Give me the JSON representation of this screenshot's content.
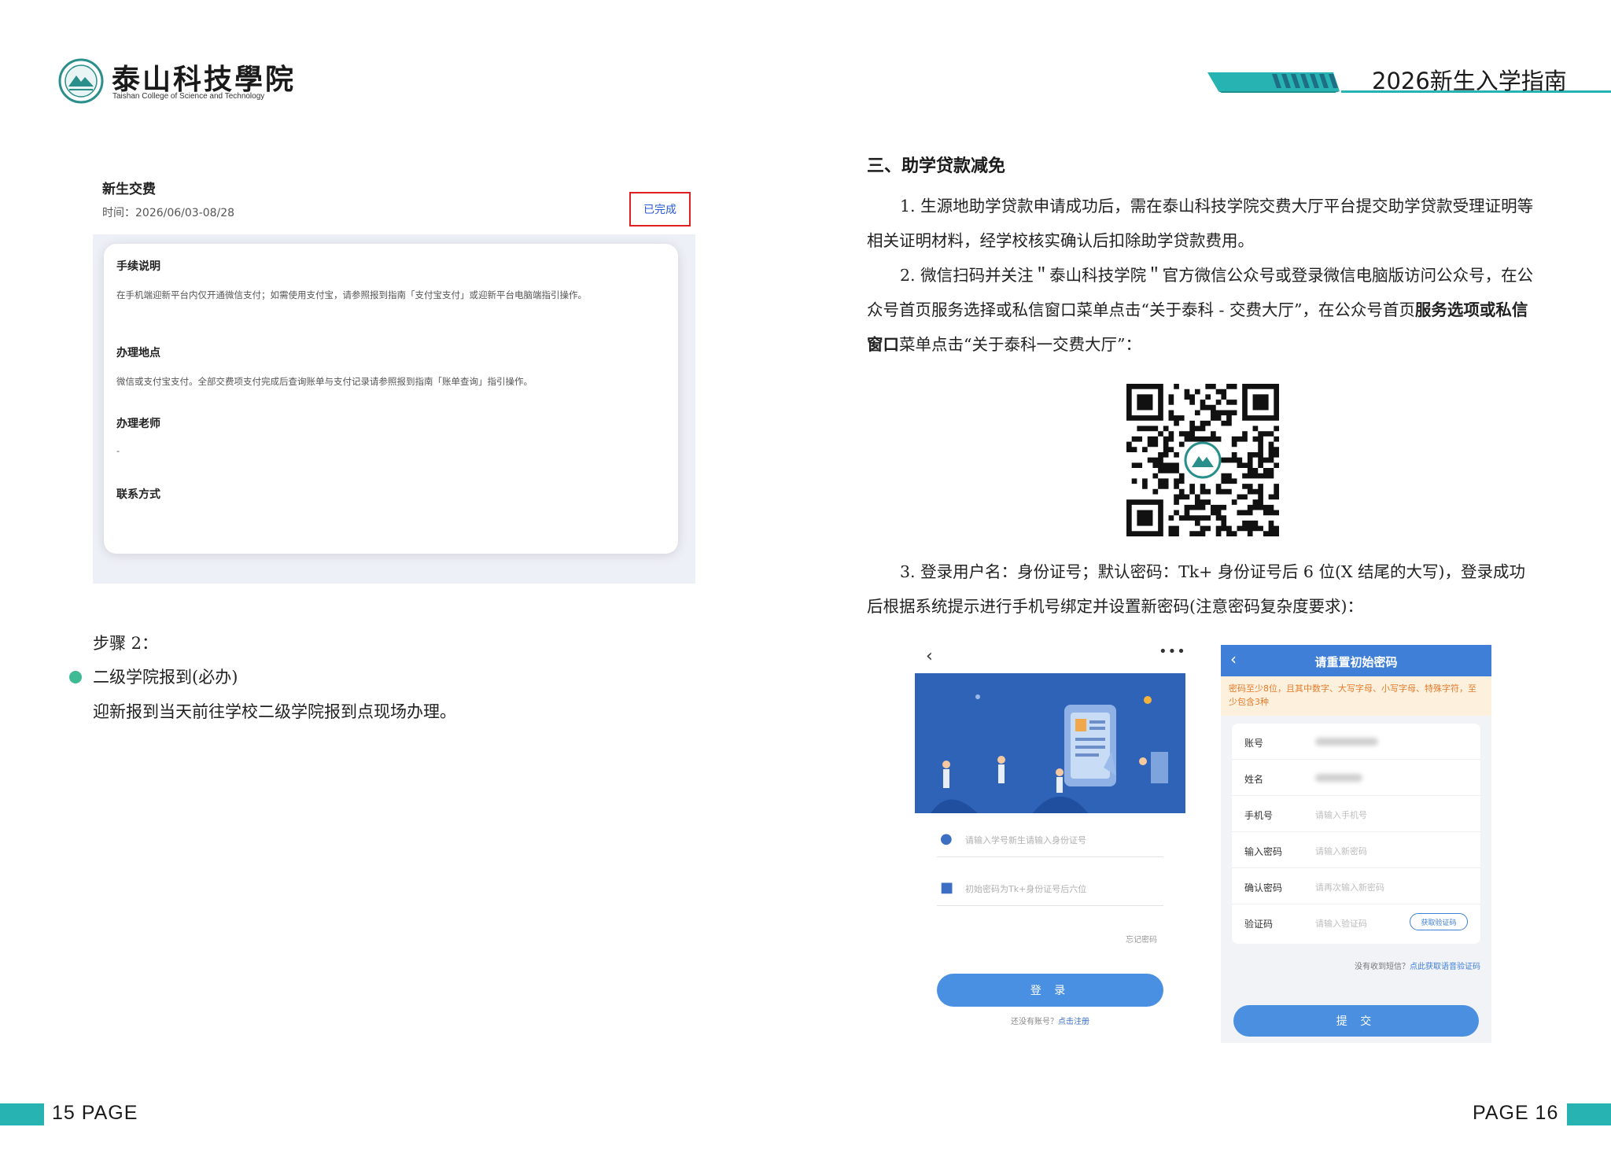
{
  "header": {
    "school_name_cn": "泰山科技學院",
    "school_name_en": "Taishan College of Science and Technology",
    "guide_title": "2026新生入学指南"
  },
  "fee_screenshot": {
    "title": "新生交费",
    "time": "时间：2026/06/03-08/28",
    "status": "已完成",
    "sections": [
      {
        "heading": "手续说明",
        "text": "在手机端迎新平台内仅开通微信支付；如需使用支付宝，请参照报到指南「支付宝支付」或迎新平台电脑端指引操作。"
      },
      {
        "heading": "办理地点",
        "text": "微信或支付宝支付。全部交费项支付完成后查询账单与支付记录请参照报到指南「账单查询」指引操作。"
      },
      {
        "heading": "办理老师",
        "text": "-"
      },
      {
        "heading": "联系方式",
        "text": ""
      }
    ]
  },
  "step2": {
    "label": "步骤 2：",
    "bullet": "二级学院报到(必办)",
    "desc": "迎新报到当天前往学校二级学院报到点现场办理。"
  },
  "section3": {
    "title": "三、助学贷款减免",
    "p1": "1. 生源地助学贷款申请成功后，需在泰山科技学院交费大厅平台提交助学贷款受理证明等相关证明材料，经学校核实确认后扣除助学贷款费用。",
    "p2_a": "2. 微信扫码并关注＂泰山科技学院＂官方微信公众号或登录微信电脑版访问公众号，在公众号首页服务选择或私信窗口菜单点击“关于泰科 - 交费大厅”，在公众号首页",
    "p2_b": "服务选项或私信窗口",
    "p2_c": "菜单点击“关于泰科一交费大厅”：",
    "p3": "3. 登录用户名：身份证号；默认密码：Tk+ 身份证号后 6 位(X 结尾的大写)，登录成功后根据系统提示进行手机号绑定并设置新密码(注意密码复杂度要求)："
  },
  "login_screen": {
    "back": "‹",
    "more": "•••",
    "username_placeholder": "请输入学号新生请输入身份证号",
    "password_placeholder": "初始密码为Tk+身份证号后六位",
    "forgot": "忘记密码",
    "login_button": "登 录",
    "register_prompt": "还没有账号？",
    "register_link": "点击注册"
  },
  "reset_screen": {
    "back": "‹",
    "title": "请重置初始密码",
    "warning": "密码至少8位，且其中数字、大写字母、小写字母、特殊字符，至少包含3种",
    "rows": [
      {
        "label": "账号",
        "value": ""
      },
      {
        "label": "姓名",
        "value": ""
      },
      {
        "label": "手机号",
        "value": "请输入手机号"
      },
      {
        "label": "输入密码",
        "value": "请输入新密码"
      },
      {
        "label": "确认密码",
        "value": "请再次输入新密码"
      },
      {
        "label": "验证码",
        "value": "请输入验证码"
      }
    ],
    "code_button": "获取验证码",
    "hint_prefix": "没有收到短信？",
    "hint_link": "点此获取语音验证码",
    "submit": "提 交"
  },
  "footer": {
    "left": "15 PAGE",
    "right": "PAGE 16"
  },
  "colors": {
    "teal": "#27b3b1",
    "blue": "#3f7fd8",
    "green_dot": "#3fbb93",
    "alert_red": "#e02020"
  }
}
